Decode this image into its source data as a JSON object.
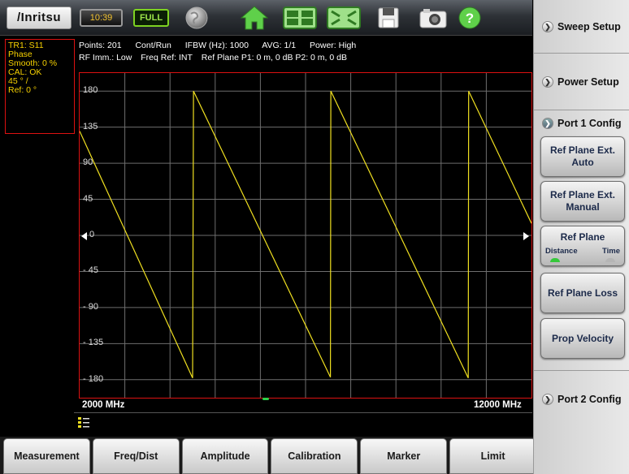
{
  "toolbar": {
    "logo_text": "/Inritsu",
    "time": "10:39",
    "battery_label": "FULL",
    "icons": [
      "globe-icon",
      "home-icon",
      "dual-trace-icon",
      "zoom-fit-icon",
      "save-icon",
      "camera-icon",
      "help-icon"
    ]
  },
  "trace_info": {
    "trace": "TR1: S11",
    "format": "Phase",
    "smooth": "Smooth: 0 %",
    "cal": "CAL: OK",
    "scale": "45 ° /",
    "ref": "Ref: 0 °"
  },
  "status": {
    "points": "Points: 201",
    "mode": "Cont/Run",
    "ifbw": "IFBW (Hz): 1000",
    "avg": "AVG: 1/1",
    "power": "Power: High",
    "rf_imm": "RF Imm.: Low",
    "freq_ref": "Freq Ref: INT",
    "ref_plane": "Ref Plane P1: 0 m, 0 dB P2: 0 m, 0 dB"
  },
  "chart_data": {
    "type": "line",
    "x_start_label": "2000 MHz",
    "x_stop_label": "12000 MHz",
    "xlim": [
      2000,
      12000
    ],
    "ylim": [
      -202.5,
      202.5
    ],
    "y_ticks": [
      180,
      135,
      90,
      45,
      0,
      -45,
      -90,
      -135,
      -180
    ],
    "y_tick_labels": [
      "180",
      "135",
      "90",
      "45",
      "0",
      "- 45",
      "- 90",
      "- 135",
      "- 180"
    ],
    "grid": true,
    "trace_color": "#f0e020",
    "series": [
      {
        "x": [
          2000,
          4500,
          4520,
          7550,
          7560,
          10600,
          10610,
          12000
        ],
        "y": [
          130,
          -178,
          180,
          -177,
          180,
          -178,
          180,
          15
        ]
      }
    ]
  },
  "tabs": [
    "Measurement",
    "Freq/Dist",
    "Amplitude",
    "Calibration",
    "Marker",
    "Limit"
  ],
  "menu": {
    "sweep_setup": "Sweep Setup",
    "power_setup": "Power Setup",
    "port1_config": "Port 1 Config",
    "ref_plane_auto": [
      "Ref Plane Ext.",
      "Auto"
    ],
    "ref_plane_manual": [
      "Ref Plane Ext.",
      "Manual"
    ],
    "ref_plane": "Ref Plane",
    "ref_plane_opt_distance": "Distance",
    "ref_plane_opt_time": "Time",
    "ref_plane_loss": "Ref Plane Loss",
    "prop_velocity": "Prop Velocity",
    "port2_config": "Port 2 Config"
  },
  "colors": {
    "trace": "#f0e020",
    "grid": "#6e6e6e",
    "border": "#d11111",
    "led_active": "#35c83a",
    "led_inactive": "#b5b5b5"
  }
}
